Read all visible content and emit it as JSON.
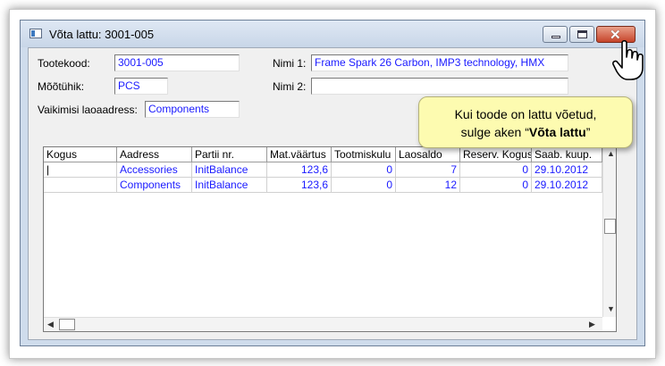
{
  "window": {
    "title": "Võta lattu: 3001-005"
  },
  "form": {
    "tootekood_label": "Tootekood:",
    "tootekood_value": "3001-005",
    "mootuhik_label": "Mõõtühik:",
    "mootuhik_value": "PCS",
    "vaikimisi_label": "Vaikimisi laoaadress:",
    "vaikimisi_value": "Components",
    "nimi1_label": "Nimi 1:",
    "nimi1_value": "Frame Spark 26 Carbon, IMP3 technology, HMX",
    "nimi2_label": "Nimi 2:",
    "nimi2_value": ""
  },
  "grid": {
    "columns": [
      "Kogus",
      "Aadress",
      "Partii nr.",
      "Mat.väärtus",
      "Tootmiskulu",
      "Laosaldo",
      "Reserv. Kogus",
      "Saab. kuup."
    ],
    "rows": [
      [
        "",
        "Accessories",
        "InitBalance",
        "123,6",
        "0",
        "7",
        "0",
        "29.10.2012"
      ],
      [
        "",
        "Components",
        "InitBalance",
        "123,6",
        "0",
        "12",
        "0",
        "29.10.2012"
      ]
    ]
  },
  "callout": {
    "line1": "Kui toode on lattu võetud,",
    "line2_prefix": "sulge aken “",
    "line2_bold": "Võta lattu",
    "line2_suffix": "”"
  },
  "colors": {
    "value_text": "#1a1aff",
    "callout_bg": "#fdfbb0"
  }
}
